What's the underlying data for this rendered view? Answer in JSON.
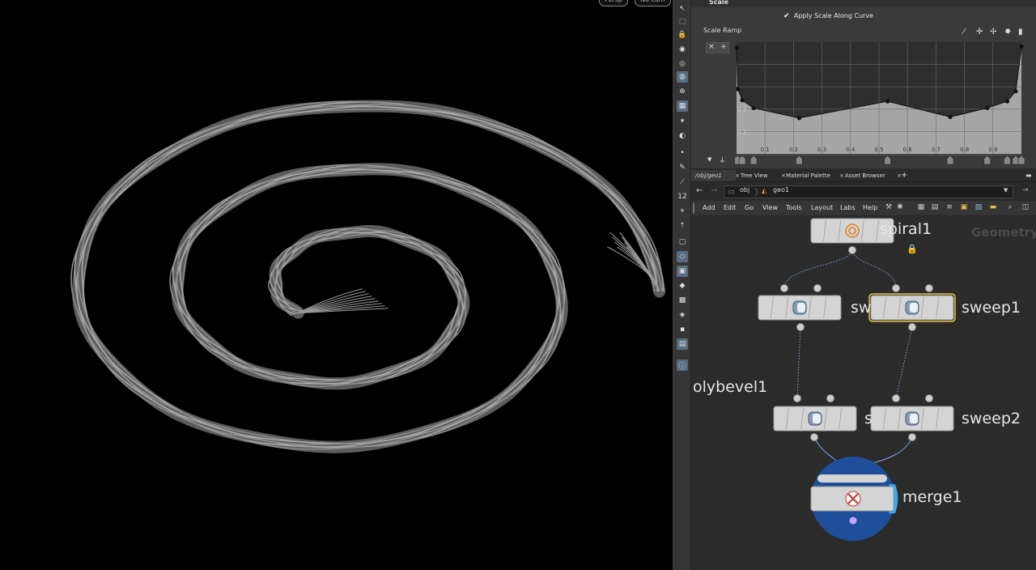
{
  "viewport": {
    "persp_label": "Persp",
    "cam_label": "No cam"
  },
  "params": {
    "section_title": "Scale",
    "apply_scale_label": "Apply Scale Along Curve",
    "ramp_label": "Scale Ramp",
    "ramp_btn_remove": "×",
    "ramp_btn_add": "+",
    "ramp_x_ticks": [
      "0.1",
      "0.2",
      "0.3",
      "0.4",
      "0.5",
      "0.6",
      "0.7",
      "0.8",
      "0.9"
    ],
    "ramp_y_ticks": [
      "0.2",
      "0.4"
    ],
    "ramp_points": [
      [
        0.0,
        0.95
      ],
      [
        0.005,
        0.58
      ],
      [
        0.02,
        0.48
      ],
      [
        0.06,
        0.41
      ],
      [
        0.22,
        0.32
      ],
      [
        0.53,
        0.47
      ],
      [
        0.75,
        0.33
      ],
      [
        0.88,
        0.41
      ],
      [
        0.95,
        0.47
      ],
      [
        0.98,
        0.56
      ],
      [
        1.0,
        0.96
      ]
    ]
  },
  "tabs": [
    {
      "label": "/obj/geo1"
    },
    {
      "label": "Tree View"
    },
    {
      "label": "Material Palette"
    },
    {
      "label": "Asset Browser"
    }
  ],
  "path": {
    "root": "obj",
    "current": "geo1"
  },
  "menus": [
    "Add",
    "Edit",
    "Go",
    "View",
    "Tools",
    "Layout",
    "Labs",
    "Help"
  ],
  "network": {
    "context_label": "Geometry",
    "nodes": {
      "spiral": "spiral1",
      "sweep_left": "sw",
      "sweep1": "sweep1",
      "polybevel": "olybevel1",
      "sweep_mid": "s",
      "sweep2": "sweep2",
      "merge": "merge1"
    }
  }
}
